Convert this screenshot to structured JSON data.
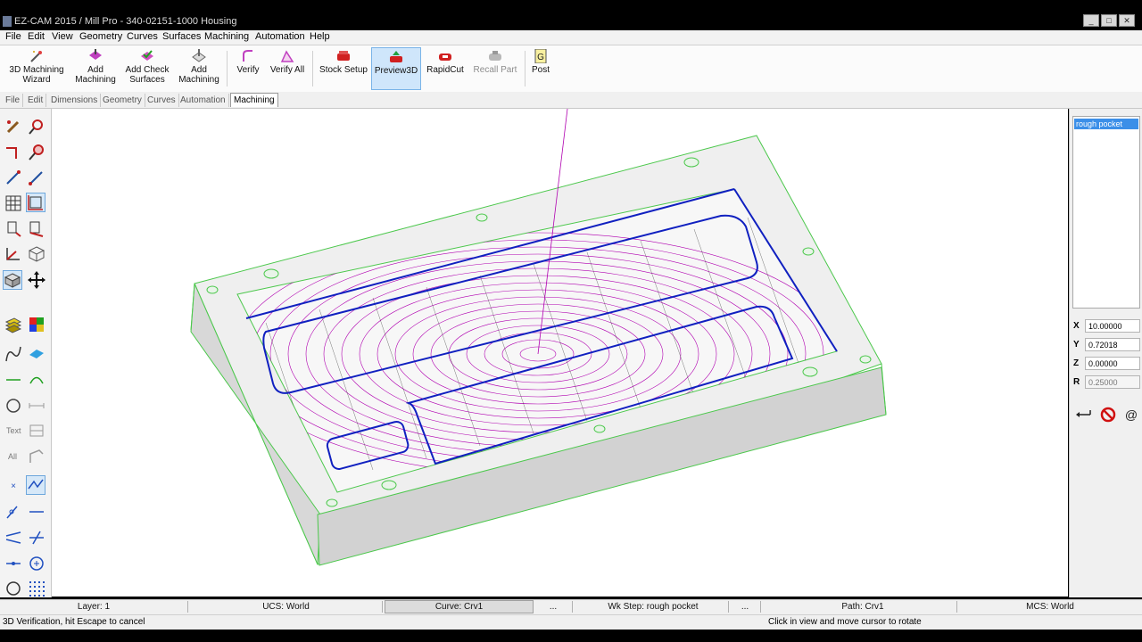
{
  "window": {
    "title": "EZ-CAM 2015 / Mill Pro - 340-02151-1000 Housing",
    "controls": [
      "_",
      "□",
      "✕"
    ]
  },
  "menu": [
    "File",
    "Edit",
    "View",
    "Geometry",
    "Curves",
    "Surfaces",
    "Machining",
    "Automation",
    "Help"
  ],
  "ribbon": {
    "buttons": [
      {
        "label1": "3D Machining",
        "label2": "Wizard",
        "icon": "wand-icon"
      },
      {
        "label1": "Add",
        "label2": "Machining",
        "icon": "add-machining-icon"
      },
      {
        "label1": "Add Check",
        "label2": "Surfaces",
        "icon": "check-surfaces-icon"
      },
      {
        "label1": "Add",
        "label2": "Machining",
        "icon": "add-3d-machining-icon"
      },
      {
        "label1": "Verify",
        "label2": "",
        "icon": "verify-icon"
      },
      {
        "label1": "Verify All",
        "label2": "",
        "icon": "verify-all-icon"
      },
      {
        "label1": "Stock Setup",
        "label2": "",
        "icon": "stock-setup-icon"
      },
      {
        "label1": "Preview3D",
        "label2": "",
        "icon": "preview3d-icon"
      },
      {
        "label1": "RapidCut",
        "label2": "",
        "icon": "rapidcut-icon"
      },
      {
        "label1": "Recall Part",
        "label2": "",
        "icon": "recall-part-icon"
      },
      {
        "label1": "Post",
        "label2": "",
        "icon": "post-g-icon"
      }
    ]
  },
  "tabs": [
    "File",
    "Edit",
    "Dimensions",
    "Geometry",
    "Curves",
    "Automation",
    "Machining"
  ],
  "active_tab": "Machining",
  "left_toolbar": {
    "text_label": "Text",
    "all_label": "All"
  },
  "operations": {
    "items": [
      "rough pocket"
    ]
  },
  "coords": {
    "x_label": "X",
    "x": "10.00000",
    "y_label": "Y",
    "y": "0.72018",
    "z_label": "Z",
    "z": "0.00000",
    "r_label": "R",
    "r": "0.25000"
  },
  "status": {
    "layer": "Layer: 1",
    "ucs": "UCS: World",
    "curve": "Curve: Crv1",
    "dots1": "...",
    "wkstep": "Wk Step: rough pocket",
    "dots2": "...",
    "path": "Path: Crv1",
    "mcs": "MCS: World"
  },
  "messages": {
    "left": "3D Verification, hit Escape to cancel",
    "right": "Click in view and move cursor to rotate"
  },
  "colors": {
    "selection": "#3b8fe8",
    "toolpath": "#b000b0",
    "boundary": "#1020c0",
    "stock_edge": "#4cc84c"
  }
}
